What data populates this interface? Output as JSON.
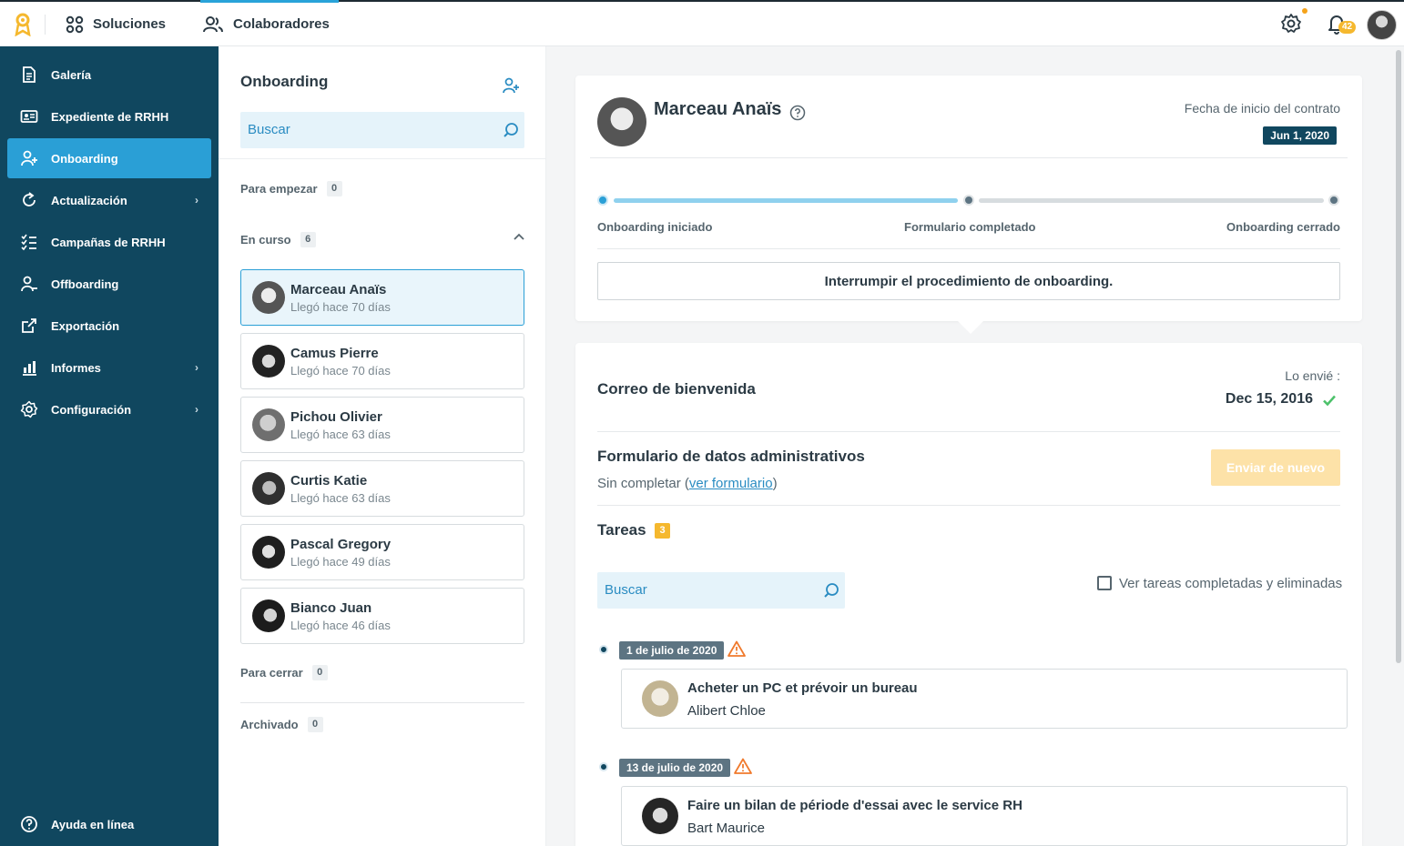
{
  "topbar": {
    "nav": [
      {
        "label": "Soluciones",
        "icon": "grid-icon"
      },
      {
        "label": "Colaboradores",
        "icon": "users-icon"
      }
    ],
    "notification_count": "42",
    "accent_color": "#29a3d9"
  },
  "sidebar": {
    "bg_color": "#10475f",
    "active_color": "#2a9fd6",
    "items": [
      {
        "label": "Galería",
        "icon": "document-icon"
      },
      {
        "label": "Expediente de RRHH",
        "icon": "id-card-icon"
      },
      {
        "label": "Onboarding",
        "icon": "user-add-icon",
        "active": true
      },
      {
        "label": "Actualización",
        "icon": "refresh-icon",
        "has_submenu": true
      },
      {
        "label": "Campañas de RRHH",
        "icon": "checklist-icon"
      },
      {
        "label": "Offboarding",
        "icon": "user-remove-icon"
      },
      {
        "label": "Exportación",
        "icon": "export-icon"
      },
      {
        "label": "Informes",
        "icon": "bar-chart-icon",
        "has_submenu": true
      },
      {
        "label": "Configuración",
        "icon": "gear-icon",
        "has_submenu": true
      }
    ],
    "help_label": "Ayuda en línea"
  },
  "list_panel": {
    "title": "Onboarding",
    "search_placeholder": "Buscar",
    "sections": {
      "to_start": {
        "label": "Para empezar",
        "count": "0"
      },
      "in_progress": {
        "label": "En curso",
        "count": "6"
      },
      "to_close": {
        "label": "Para cerrar",
        "count": "0"
      },
      "archived": {
        "label": "Archivado",
        "count": "0"
      }
    },
    "people": [
      {
        "name": "Marceau Anaïs",
        "sub": "Llegó hace 70 días"
      },
      {
        "name": "Camus Pierre",
        "sub": "Llegó hace 70 días"
      },
      {
        "name": "Pichou Olivier",
        "sub": "Llegó hace 63 días"
      },
      {
        "name": "Curtis Katie",
        "sub": "Llegó hace 63 días"
      },
      {
        "name": "Pascal Gregory",
        "sub": "Llegó hace 49 días"
      },
      {
        "name": "Bianco Juan",
        "sub": "Llegó hace 46 días"
      }
    ]
  },
  "employee": {
    "name": "Marceau Anaïs",
    "contract_label": "Fecha de inicio del contrato",
    "contract_date": "Jun 1, 2020",
    "progress": {
      "steps": [
        "Onboarding iniciado",
        "Formulario completado",
        "Onboarding cerrado"
      ],
      "completed_fraction": 0.5
    },
    "interrupt_label": "Interrumpir el procedimiento de onboarding."
  },
  "details": {
    "welcome_title": "Correo de bienvenida",
    "sent_label": "Lo envié :",
    "sent_date": "Dec 15, 2016",
    "form_title": "Formulario de datos administrativos",
    "form_status_prefix": "Sin completar (",
    "form_link": "ver formulario",
    "form_status_suffix": ")",
    "resend_label": "Enviar de nuevo",
    "tasks_title": "Tareas",
    "tasks_count": "3",
    "task_search_placeholder": "Buscar",
    "show_completed_label": "Ver tareas completadas y eliminadas",
    "tasks": [
      {
        "date": "1 de julio de 2020",
        "title": "Acheter un PC et prévoir un bureau",
        "person": "Alibert Chloe"
      },
      {
        "date": "13 de julio de 2020",
        "title": "Faire un bilan de période d'essai avec le service RH",
        "person": "Bart Maurice"
      }
    ]
  }
}
